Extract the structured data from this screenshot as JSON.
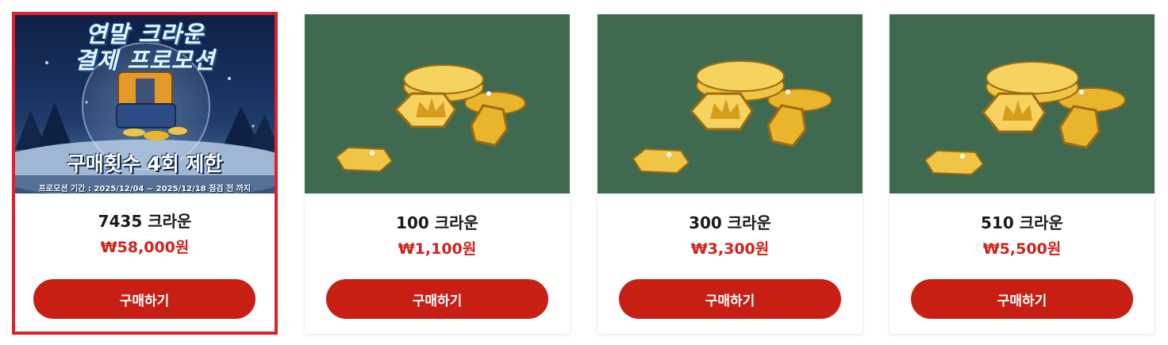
{
  "products": [
    {
      "name": "7435 크라운",
      "price": "₩58,000원",
      "button": "구매하기",
      "featured": true,
      "image": {
        "kind": "promo-banner",
        "title_line1": "연말 크라운",
        "title_line2": "결제 프로모션",
        "limit_text": "구매횟수 4회 제한",
        "period_text": "프로모션 기간 : 2025/12/04 ~ 2025/12/18 점검 전 까지"
      }
    },
    {
      "name": "100 크라운",
      "price": "₩1,100원",
      "button": "구매하기",
      "featured": false,
      "image": {
        "kind": "crown-coins"
      }
    },
    {
      "name": "300 크라운",
      "price": "₩3,300원",
      "button": "구매하기",
      "featured": false,
      "image": {
        "kind": "crown-coins"
      }
    },
    {
      "name": "510 크라운",
      "price": "₩5,500원",
      "button": "구매하기",
      "featured": false,
      "image": {
        "kind": "crown-coins"
      }
    }
  ],
  "colors": {
    "accent_red": "#c81f14",
    "price_red": "#d0231c",
    "selected_border": "#e0202a",
    "coin_background": "#3f6a50",
    "coin_gold": "#e8b52c"
  }
}
